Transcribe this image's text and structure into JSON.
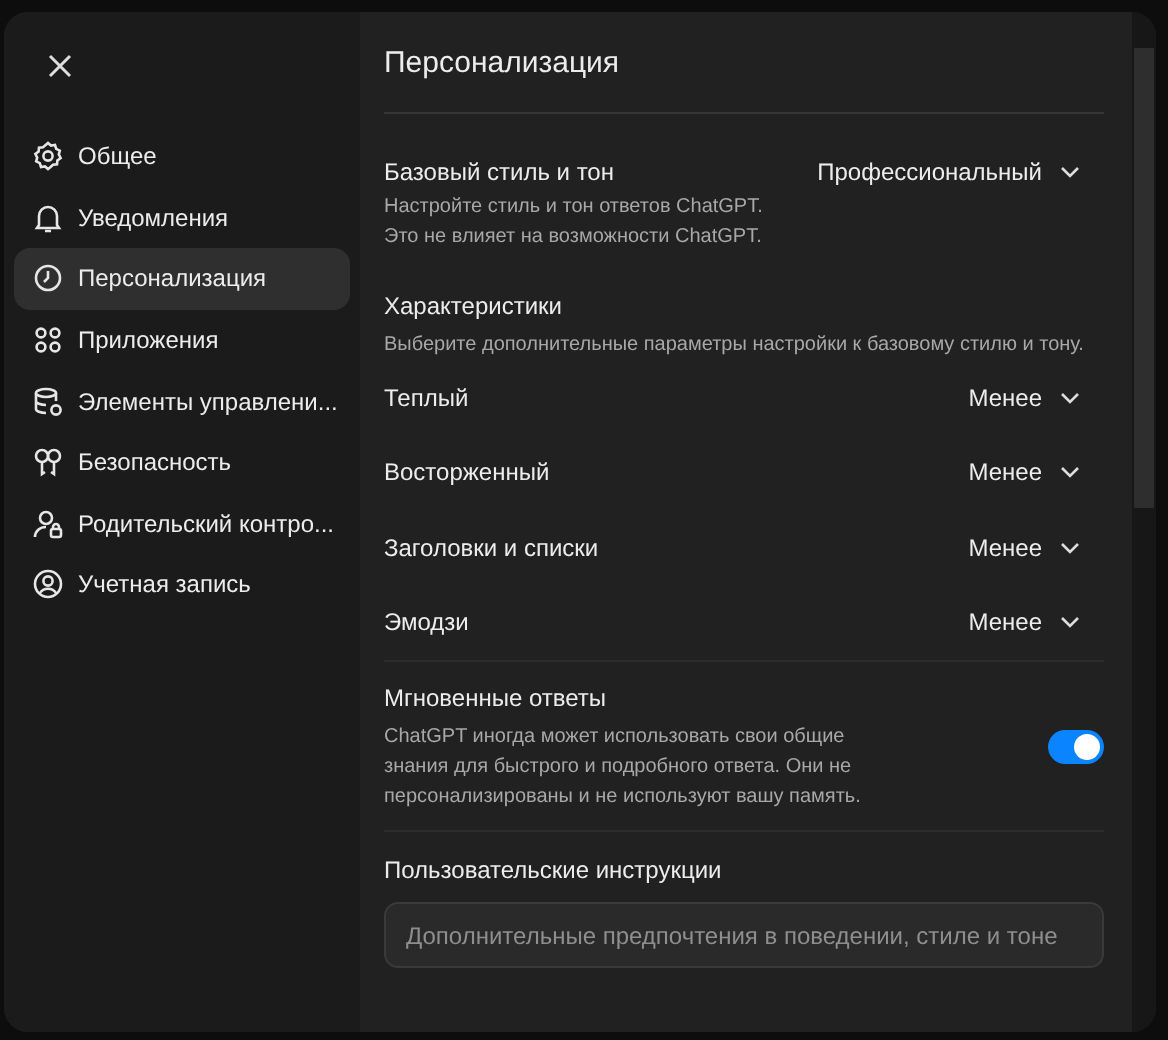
{
  "sidebar": {
    "items": [
      {
        "label": "Общее",
        "selected": false
      },
      {
        "label": "Уведомления",
        "selected": false
      },
      {
        "label": "Персонализация",
        "selected": true
      },
      {
        "label": "Приложения",
        "selected": false
      },
      {
        "label": "Элементы управлени...",
        "selected": false
      },
      {
        "label": "Безопасность",
        "selected": false
      },
      {
        "label": "Родительский контро...",
        "selected": false
      },
      {
        "label": "Учетная запись",
        "selected": false
      }
    ]
  },
  "title": "Персонализация",
  "base_style": {
    "label": "Базовый стиль и тон",
    "value": "Профессиональный",
    "description": [
      "Настройте стиль и тон ответов ChatGPT.",
      "Это не влияет на возможности ChatGPT."
    ]
  },
  "characteristics": {
    "label": "Характеристики",
    "description": "Выберите дополнительные параметры настройки к базовому стилю и тону.",
    "items": [
      {
        "label": "Теплый",
        "value": "Менее"
      },
      {
        "label": "Восторженный",
        "value": "Менее"
      },
      {
        "label": "Заголовки и списки",
        "value": "Менее"
      },
      {
        "label": "Эмодзи",
        "value": "Менее"
      }
    ]
  },
  "instant_answers": {
    "label": "Мгновенные ответы",
    "description": [
      "ChatGPT иногда может использовать свои общие",
      "знания для быстрого и подробного ответа. Они не",
      "персонализированы и не используют вашу память."
    ],
    "on": true
  },
  "custom_instructions": {
    "label": "Пользовательские инструкции",
    "placeholder": "Дополнительные предпочтения в поведении, стиле и тоне"
  }
}
